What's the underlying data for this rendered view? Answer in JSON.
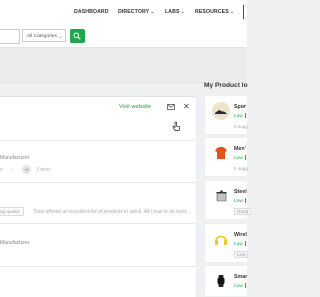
{
  "nav": {
    "dashboard": "DASHBOARD",
    "directory": "DIRECTORY",
    "labs": "LABS",
    "resources": "RESOURCES"
  },
  "search": {
    "category": "All Categories"
  },
  "panel": {
    "visit_label": "Visit website",
    "rows": [
      {
        "text_a": "Manufacturer",
        "text_b": "s",
        "text_c": "...",
        "badge": "+1",
        "meta": "3 mins"
      },
      {
        "text_a": "ng quality",
        "text_b": "They offered an excellent list of products in stock. All i how to do trust..."
      },
      {
        "text_a": "Manufacturer"
      }
    ]
  },
  "sidebar": {
    "title": "My Product lo",
    "products": [
      {
        "name": "Spor",
        "level": "Low",
        "extra": "5 sugg"
      },
      {
        "name": "Men'",
        "level": "Low",
        "extra": "5 sugg"
      },
      {
        "name": "Steel",
        "level": "Low",
        "extra": "Good"
      },
      {
        "name": "Wirel",
        "level": "Low",
        "extra": "Low"
      },
      {
        "name": "Smar",
        "level": "Low"
      }
    ]
  },
  "colors": {
    "accent": "#1ea84a",
    "brand_red": "#c71f1f"
  }
}
